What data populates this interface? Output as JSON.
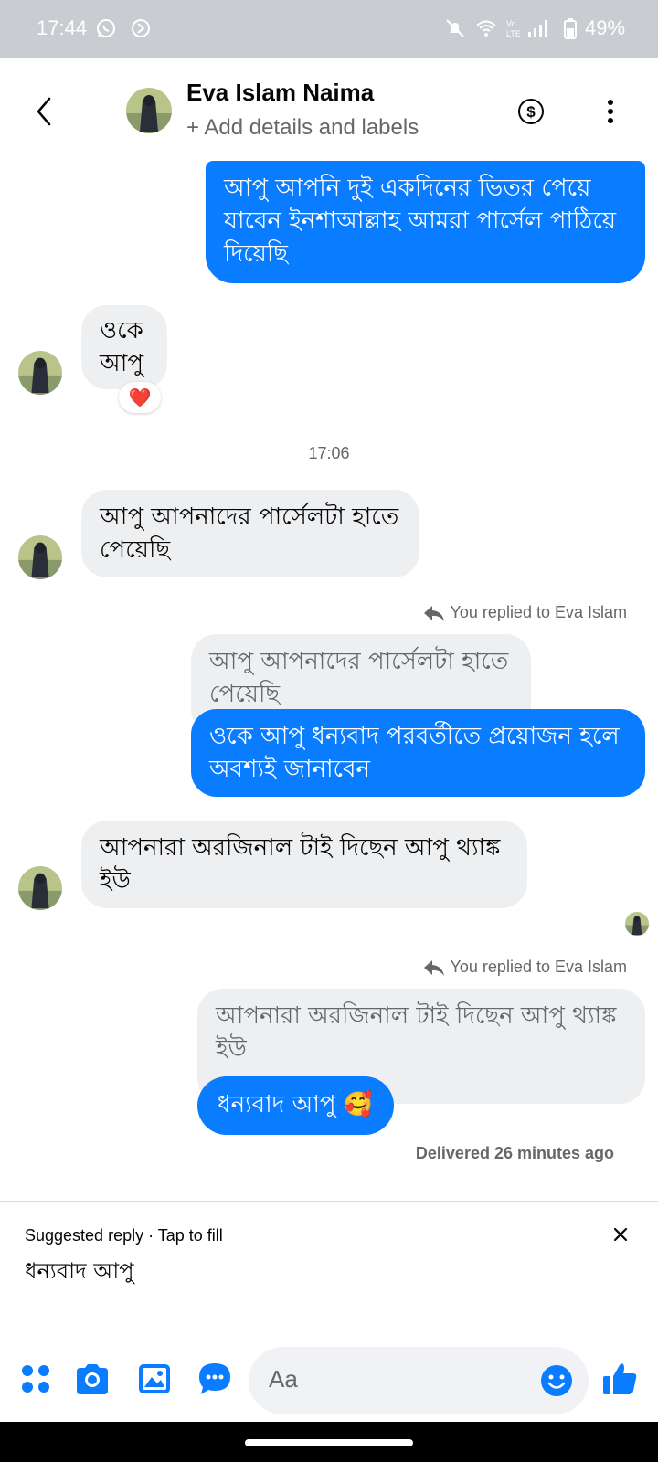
{
  "status_bar": {
    "time": "17:44",
    "battery": "49%",
    "icons": [
      "whatsapp-icon",
      "nav-icon",
      "mute-icon",
      "wifi-icon",
      "volte-icon",
      "signal-icon",
      "battery-icon"
    ]
  },
  "header": {
    "contact_name": "Eva Islam Naima",
    "subtitle": "+ Add details and labels",
    "icons": [
      "back-icon",
      "dollar-icon",
      "more-icon"
    ]
  },
  "messages": {
    "m1": "আপু আপনি দুই একদিনের ভিতর পেয়ে যাবেন ইনশাআল্লাহ আমরা পার্সেল পাঠিয়ে দিয়েছি",
    "m2": "ওকে আপু",
    "m2_reaction": "❤️",
    "timestamp": "17:06",
    "m3": "আপু আপনাদের পার্সেলটা হাতে পেয়েছি",
    "reply_label_1": "You replied to Eva Islam",
    "m4_quote": "আপু আপনাদের পার্সেলটা হাতে পেয়েছি",
    "m4": "ওকে আপু ধন্যবাদ পরবর্তীতে প্রয়োজন হলে অবশ্যই জানাবেন",
    "m5": "আপনারা অরজিনাল টাই দিছেন আপু থ্যাঙ্ক ইউ",
    "reply_label_2": "You replied to Eva Islam",
    "m6_quote": "আপনারা অরজিনাল টাই দিছেন আপু থ্যাঙ্ক ইউ",
    "m6": "ধন্যবাদ আপু 🥰",
    "delivered": "Delivered 26 minutes ago"
  },
  "suggestion": {
    "label": "Suggested reply · Tap to fill",
    "text": "ধন্যবাদ আপু"
  },
  "composer": {
    "placeholder": "Aa",
    "icons": [
      "apps-icon",
      "camera-icon",
      "gallery-icon",
      "chat-bubble-icon",
      "emoji-icon",
      "like-icon"
    ]
  },
  "colors": {
    "accent": "#0a7cff",
    "incoming_bubble": "#eeeff1",
    "status_bar": "#c9ccd1",
    "secondary_text": "#65676b"
  }
}
